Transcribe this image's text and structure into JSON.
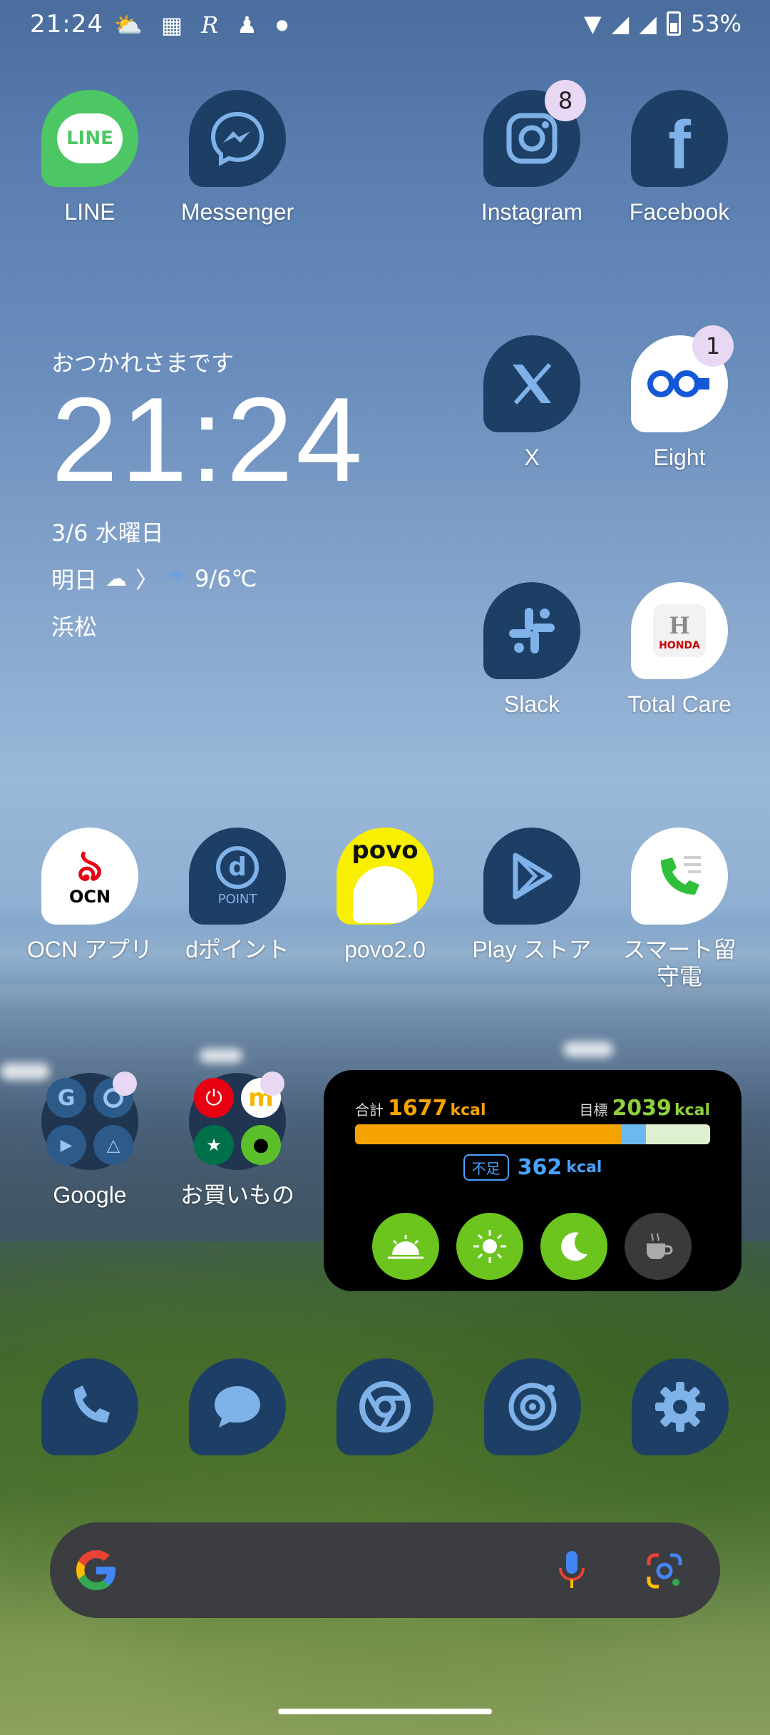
{
  "status_bar": {
    "time": "21:24",
    "battery": "53%"
  },
  "apps": {
    "line": "LINE",
    "messenger": "Messenger",
    "instagram": "Instagram",
    "instagram_badge": "8",
    "facebook": "Facebook",
    "x": "X",
    "eight": "Eight",
    "eight_badge": "1",
    "slack": "Slack",
    "total_care": "Total Care",
    "ocn": "OCN アプリ",
    "dpoint": "dポイント",
    "povo": "povo2.0",
    "play": "Play ストア",
    "smart": "スマート留\n守電",
    "google_folder": "Google",
    "shopping_folder": "お買いもの"
  },
  "app_icon_text": {
    "line": "LINE",
    "ocn": "OCN",
    "dpoint_letter": "d",
    "dpoint_word": "POINT",
    "povo": "povo",
    "honda": "HONDA"
  },
  "clock_widget": {
    "greeting": "おつかれさまです",
    "time": "21:24",
    "date": "3/6 水曜日",
    "tomorrow_label": "明日",
    "temps": "9/6℃",
    "city": "浜松"
  },
  "calorie_widget": {
    "total_label": "合計",
    "total_value": "1677",
    "unit": "kcal",
    "goal_label": "目標",
    "goal_value": "2039",
    "deficit_label": "不足",
    "deficit_value": "362",
    "progress_eaten": 0.75,
    "progress_extra": 0.07,
    "meals": [
      "breakfast",
      "lunch",
      "dinner",
      "snack"
    ]
  },
  "colors": {
    "icon_bg": "#1d3f66",
    "kcal_orange": "#f5a300",
    "kcal_green": "#6cc41e",
    "kcal_blue": "#4aa3ff"
  }
}
